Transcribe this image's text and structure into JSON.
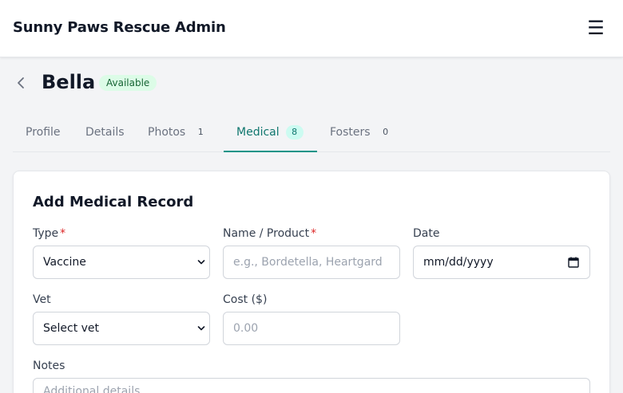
{
  "app": {
    "title": "Sunny Paws Rescue Admin",
    "menu_icon": "hamburger-icon",
    "menu_glyph": "☰"
  },
  "pet": {
    "name": "Bella",
    "status": "Available"
  },
  "tabs": [
    {
      "label": "Profile",
      "count": null,
      "active": false
    },
    {
      "label": "Details",
      "count": null,
      "active": false
    },
    {
      "label": "Photos",
      "count": "1",
      "active": false
    },
    {
      "label": "Medical",
      "count": "8",
      "active": true
    },
    {
      "label": "Fosters",
      "count": "0",
      "active": false
    }
  ],
  "form": {
    "title": "Add Medical Record",
    "required_marker": "*",
    "type": {
      "label": "Type",
      "value": "Vaccine"
    },
    "name": {
      "label": "Name / Product",
      "placeholder": "e.g., Bordetella, Heartgard"
    },
    "date": {
      "label": "Date",
      "placeholder": "mm/dd/yyyy"
    },
    "vet": {
      "label": "Vet",
      "value": "Select vet"
    },
    "cost": {
      "label": "Cost ($)",
      "placeholder": "0.00"
    },
    "notes": {
      "label": "Notes",
      "placeholder": "Additional details"
    }
  },
  "colors": {
    "accent": "#0d9488",
    "badge_bg": "#dcfce7",
    "badge_text": "#166534",
    "required": "#dc2626"
  }
}
